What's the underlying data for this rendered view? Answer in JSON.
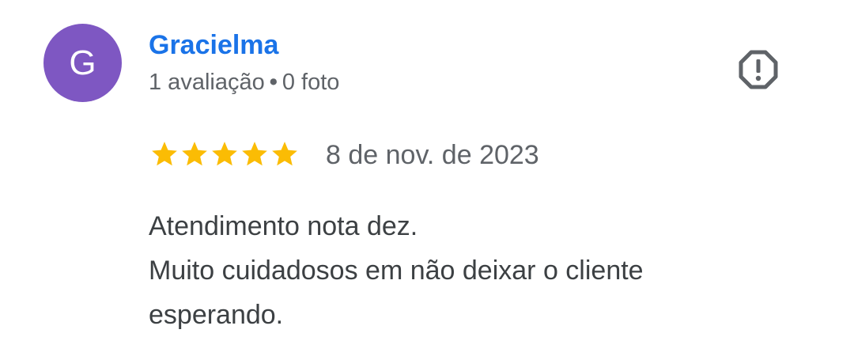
{
  "reviewer": {
    "initial": "G",
    "name": "Gracielma",
    "reviews_count": "1 avaliação",
    "separator": "•",
    "photos_count": "0 foto"
  },
  "review": {
    "rating": 5,
    "max_rating": 5,
    "date": "8 de nov. de 2023",
    "text_lines": [
      "Atendimento nota dez.",
      "Muito cuidadosos em não deixar o cliente",
      "esperando."
    ]
  },
  "icons": {
    "report": "report-flag-icon",
    "star": "star-icon"
  },
  "colors": {
    "avatar_bg": "#7e57c2",
    "name": "#1a73e8",
    "star": "#fbbc04",
    "icon": "#5f6368"
  }
}
